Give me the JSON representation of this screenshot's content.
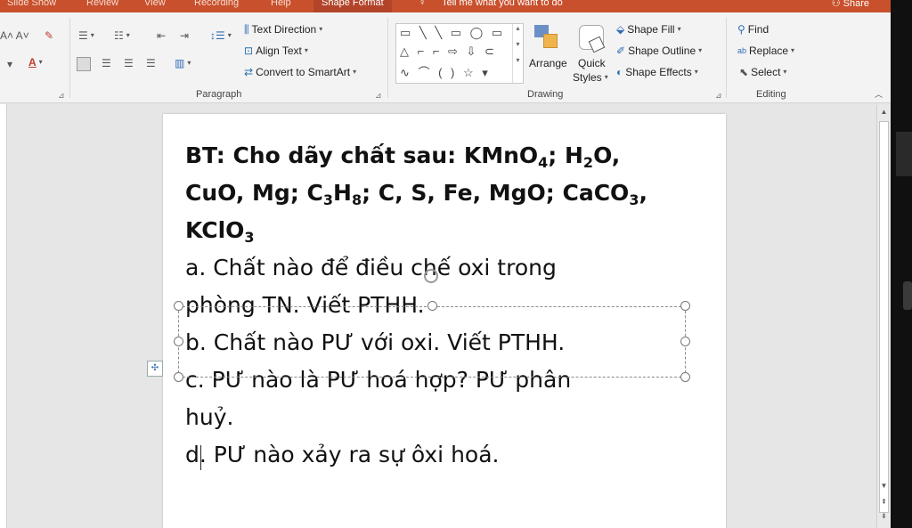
{
  "tabs": [
    "Slide Show",
    "Review",
    "View",
    "Recording",
    "Help",
    "Shape Format"
  ],
  "active_tab": "Shape Format",
  "tell_me": "Tell me what you want to do",
  "share": "Share",
  "ribbon": {
    "paragraph": {
      "label": "Paragraph",
      "text_direction": "Text Direction",
      "align_text": "Align Text",
      "convert_smartart": "Convert to SmartArt"
    },
    "drawing": {
      "label": "Drawing",
      "arrange": "Arrange",
      "quick": "Quick",
      "styles": "Styles",
      "shape_fill": "Shape Fill",
      "shape_outline": "Shape Outline",
      "shape_effects": "Shape Effects"
    },
    "editing": {
      "label": "Editing",
      "find": "Find",
      "replace": "Replace",
      "select": "Select"
    }
  },
  "slide": {
    "title_line1_a": "BT: Cho dãy chất sau: KMnO",
    "title_line1_sub1": "4",
    "title_line1_b": "; H",
    "title_line1_sub2": "2",
    "title_line1_c": "O,",
    "title_line2_a": "CuO, Mg; C",
    "title_line2_sub1": "3",
    "title_line2_b": "H",
    "title_line2_sub2": "8",
    "title_line2_c": "; C, S, Fe, MgO; CaCO",
    "title_line2_sub3": "3",
    "title_line2_d": ",",
    "title_line3_a": "KClO",
    "title_line3_sub": "3",
    "item_a_line1": "a. Chất nào để điều chế oxi trong",
    "item_a_line2": "phòng TN. Viết PTHH.",
    "item_b": "b. Chất nào PƯ với oxi. Viết PTHH.",
    "item_c_line1": "c. PƯ nào là PƯ hoá hợp? PƯ phân",
    "item_c_line2": "huỷ.",
    "item_d": "d. PƯ nào xảy ra sự ôxi hoá."
  }
}
